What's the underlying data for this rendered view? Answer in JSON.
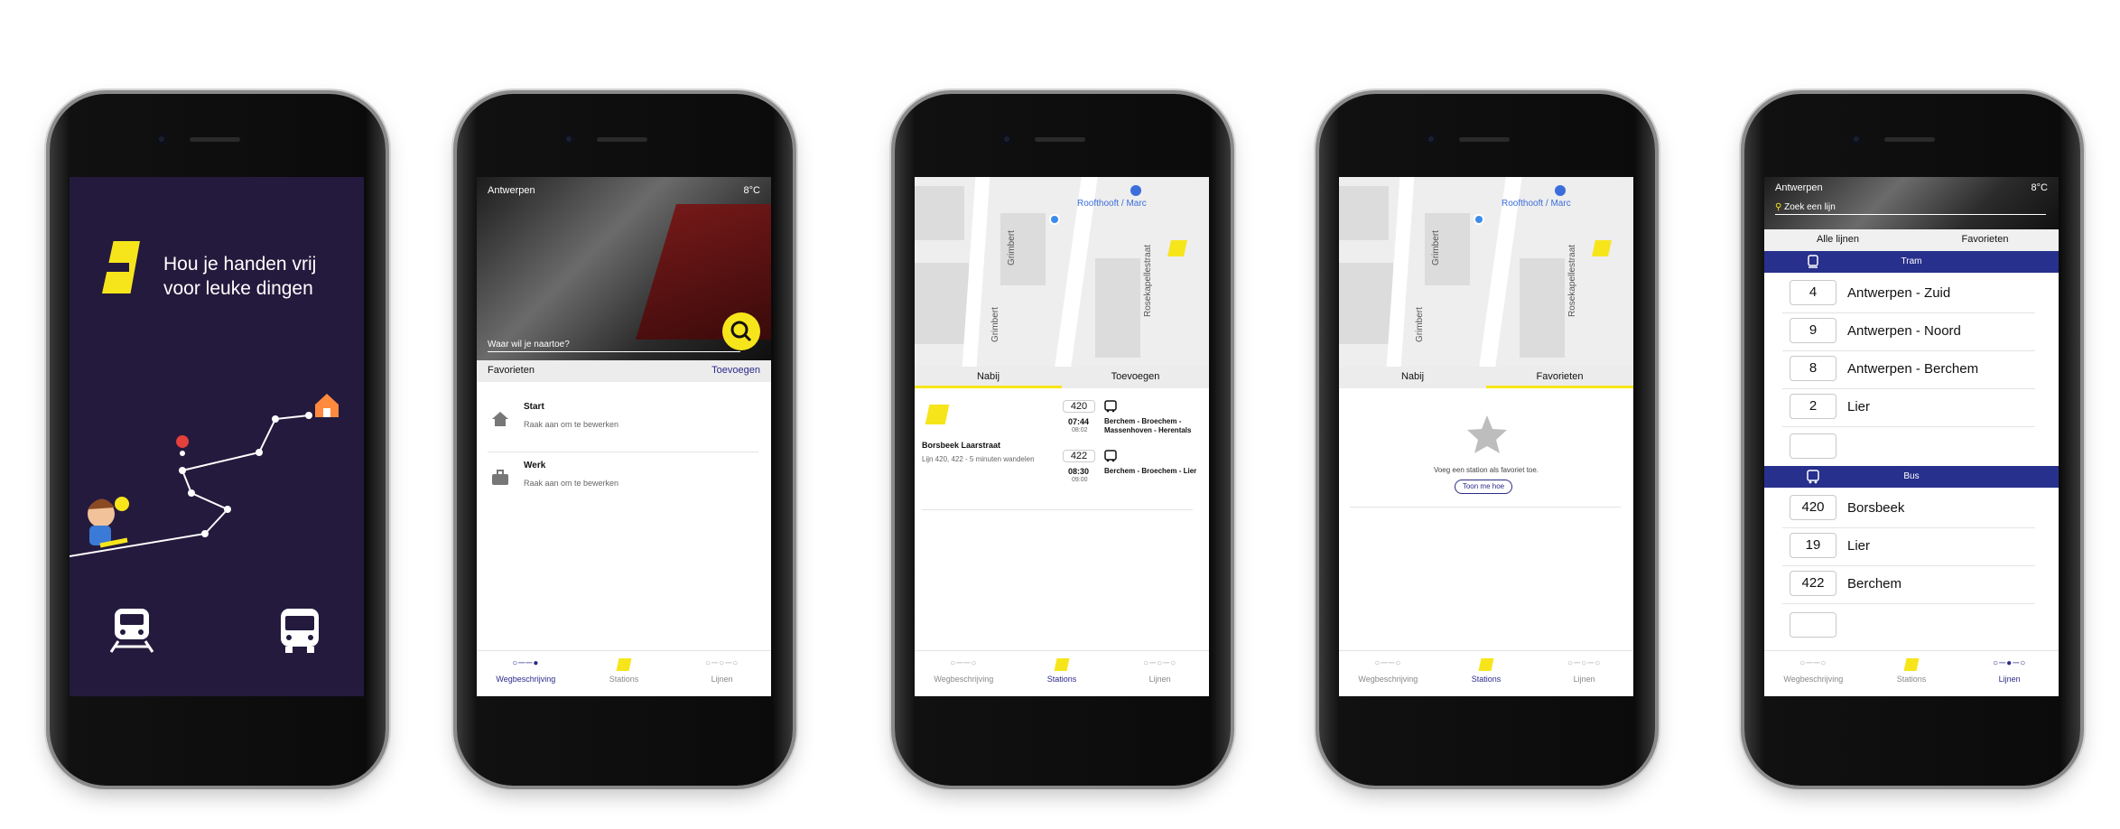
{
  "screen1": {
    "tagline_line1": "Hou je handen vrij",
    "tagline_line2": "voor leuke dingen",
    "train_icon": "train-icon",
    "bus_icon": "bus-icon",
    "colors": {
      "bg": "#241a3d",
      "accent": "#f7e51c"
    }
  },
  "screen2": {
    "city": "Antwerpen",
    "temp": "8°C",
    "search_placeholder": "Waar wil je naartoe?",
    "fav_title": "Favorieten",
    "fav_add": "Toevoegen",
    "items": [
      {
        "title": "Start",
        "sub": "Raak aan om te bewerken",
        "icon": "home-icon"
      },
      {
        "title": "Werk",
        "sub": "Raak aan om te bewerken",
        "icon": "briefcase-icon"
      }
    ],
    "nav": [
      "Wegbeschrijving",
      "Stations",
      "Lijnen"
    ]
  },
  "screen3": {
    "map_street1": "Grimbert",
    "map_street2": "Grimbert",
    "map_street3": "Rosekapellestraat",
    "map_place": "Roofthooft / Marc",
    "tab_nearby": "Nabij",
    "tab_add": "Toevoegen",
    "station_name": "Borsbeek Laarstraat",
    "station_sub": "Lijn 420, 422 - 5 minuten wandelen",
    "departures": [
      {
        "line": "420",
        "time": "07:44",
        "time2": "08:02",
        "dest": "Berchem - Broechem - Massenhoven - Herentals"
      },
      {
        "line": "422",
        "time": "08:30",
        "time2": "09:00",
        "dest": "Berchem - Broechem - Lier"
      }
    ],
    "nav": [
      "Wegbeschrijving",
      "Stations",
      "Lijnen"
    ]
  },
  "screen4": {
    "map_street1": "Grimbert",
    "map_street2": "Grimbert",
    "map_street3": "Rosekapellestraat",
    "map_place": "Roofthooft / Marc",
    "tab_nearby": "Nabij",
    "tab_fav": "Favorieten",
    "empty_text": "Voeg een station als favoriet toe.",
    "empty_button": "Toon me hoe",
    "nav": [
      "Wegbeschrijving",
      "Stations",
      "Lijnen"
    ]
  },
  "screen5": {
    "city": "Antwerpen",
    "temp": "8°C",
    "search_placeholder": "Zoek een lijn",
    "tab_all": "Alle lijnen",
    "tab_fav": "Favorieten",
    "tram_label": "Tram",
    "bus_label": "Bus",
    "tram_lines": [
      {
        "num": "4",
        "name": "Antwerpen - Zuid"
      },
      {
        "num": "9",
        "name": "Antwerpen - Noord"
      },
      {
        "num": "8",
        "name": "Antwerpen - Berchem"
      },
      {
        "num": "2",
        "name": "Lier"
      }
    ],
    "bus_lines": [
      {
        "num": "420",
        "name": "Borsbeek"
      },
      {
        "num": "19",
        "name": "Lier"
      },
      {
        "num": "422",
        "name": "Berchem"
      }
    ],
    "nav": [
      "Wegbeschrijving",
      "Stations",
      "Lijnen"
    ]
  }
}
